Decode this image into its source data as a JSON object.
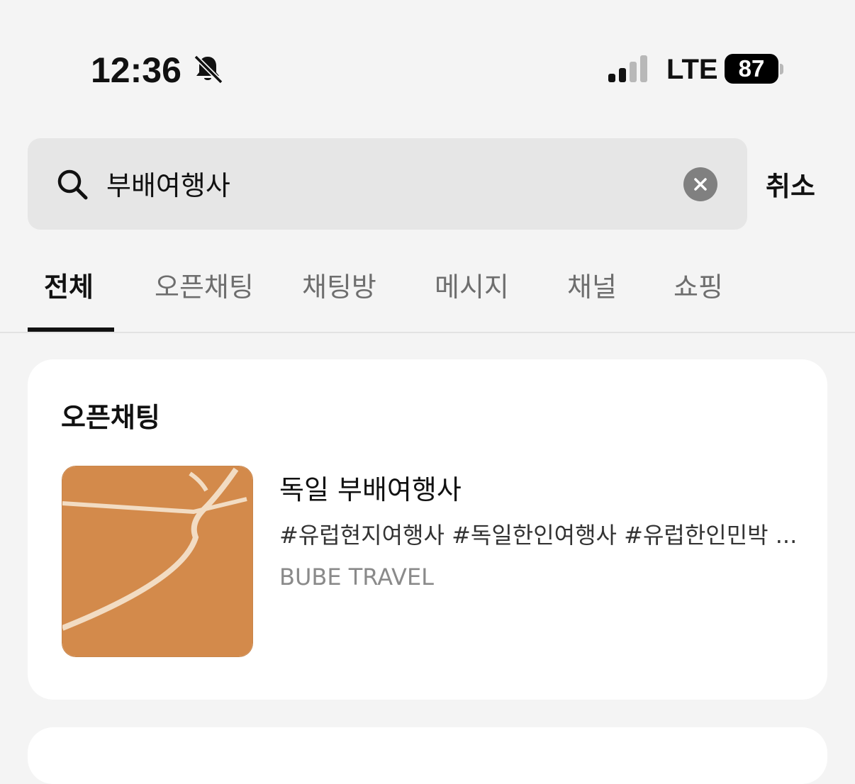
{
  "status_bar": {
    "time": "12:36",
    "network": "LTE",
    "battery": "87",
    "icons": [
      "bell-muted-icon",
      "signal-icon"
    ]
  },
  "search": {
    "value": "부배여행사",
    "placeholder": "",
    "cancel_label": "취소",
    "icons": [
      "search-icon",
      "clear-icon"
    ]
  },
  "tabs": [
    {
      "label": "전체",
      "active": true
    },
    {
      "label": "오픈채팅",
      "active": false
    },
    {
      "label": "채팅방",
      "active": false
    },
    {
      "label": "메시지",
      "active": false
    },
    {
      "label": "채널",
      "active": false
    },
    {
      "label": "쇼핑",
      "active": false
    }
  ],
  "open_chat_section": {
    "title": "오픈채팅",
    "results": [
      {
        "title": "독일 부배여행사",
        "tags": "#유럽현지여행사 #독일한인여행사 #유럽한인민박 ...",
        "subtitle": "BUBE TRAVEL"
      }
    ]
  },
  "colors": {
    "background": "#f4f4f4",
    "search_bg": "#e6e6e6",
    "thumbnail": "#d38a4b"
  }
}
